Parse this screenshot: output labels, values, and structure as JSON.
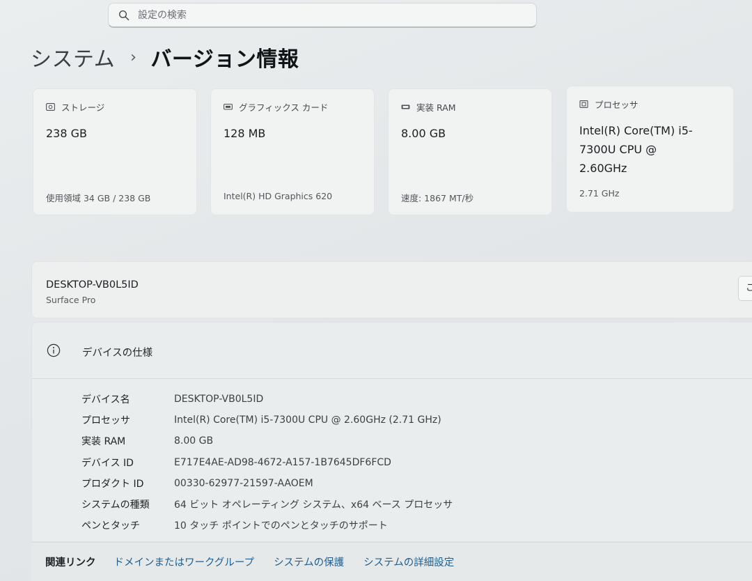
{
  "search": {
    "placeholder": "設定の検索"
  },
  "breadcrumb": {
    "parent": "システム",
    "separator": "›",
    "current": "バージョン情報"
  },
  "cards": [
    {
      "title": "ストレージ",
      "value": "238 GB",
      "sub": "使用領域 34 GB / 238 GB",
      "icon": "storage-icon"
    },
    {
      "title": "グラフィックス カード",
      "value": "128 MB",
      "sub": "Intel(R) HD Graphics 620",
      "icon": "graphics-card-icon"
    },
    {
      "title": "実装 RAM",
      "value": "8.00 GB",
      "sub": "速度: 1867 MT/秒",
      "icon": "ram-icon"
    },
    {
      "title": "プロセッサ",
      "value": "Intel(R) Core(TM) i5-7300U CPU @ 2.60GHz",
      "sub": "2.71 GHz",
      "icon": "processor-icon"
    }
  ],
  "device": {
    "name": "DESKTOP-VB0L5ID",
    "model": "Surface Pro",
    "rename_button": "こ"
  },
  "specs": {
    "title": "デバイスの仕様",
    "rows": [
      {
        "label": "デバイス名",
        "value": "DESKTOP-VB0L5ID"
      },
      {
        "label": "プロセッサ",
        "value": "Intel(R) Core(TM) i5-7300U CPU @ 2.60GHz (2.71 GHz)"
      },
      {
        "label": "実装 RAM",
        "value": "8.00 GB"
      },
      {
        "label": "デバイス ID",
        "value": "E717E4AE-AD98-4672-A157-1B7645DF6FCD"
      },
      {
        "label": "プロダクト ID",
        "value": "00330-62977-21597-AAOEM"
      },
      {
        "label": "システムの種類",
        "value": "64 ビット オペレーティング システム、x64 ベース プロセッサ"
      },
      {
        "label": "ペンとタッチ",
        "value": "10 タッチ ポイントでのペンとタッチのサポート"
      }
    ]
  },
  "related": {
    "label": "関連リンク",
    "links": [
      "ドメインまたはワークグループ",
      "システムの保護",
      "システムの詳細設定"
    ]
  },
  "colors": {
    "link": "#1f5e8f",
    "background": "#e3e7e9",
    "card": "#f1f3f3"
  }
}
